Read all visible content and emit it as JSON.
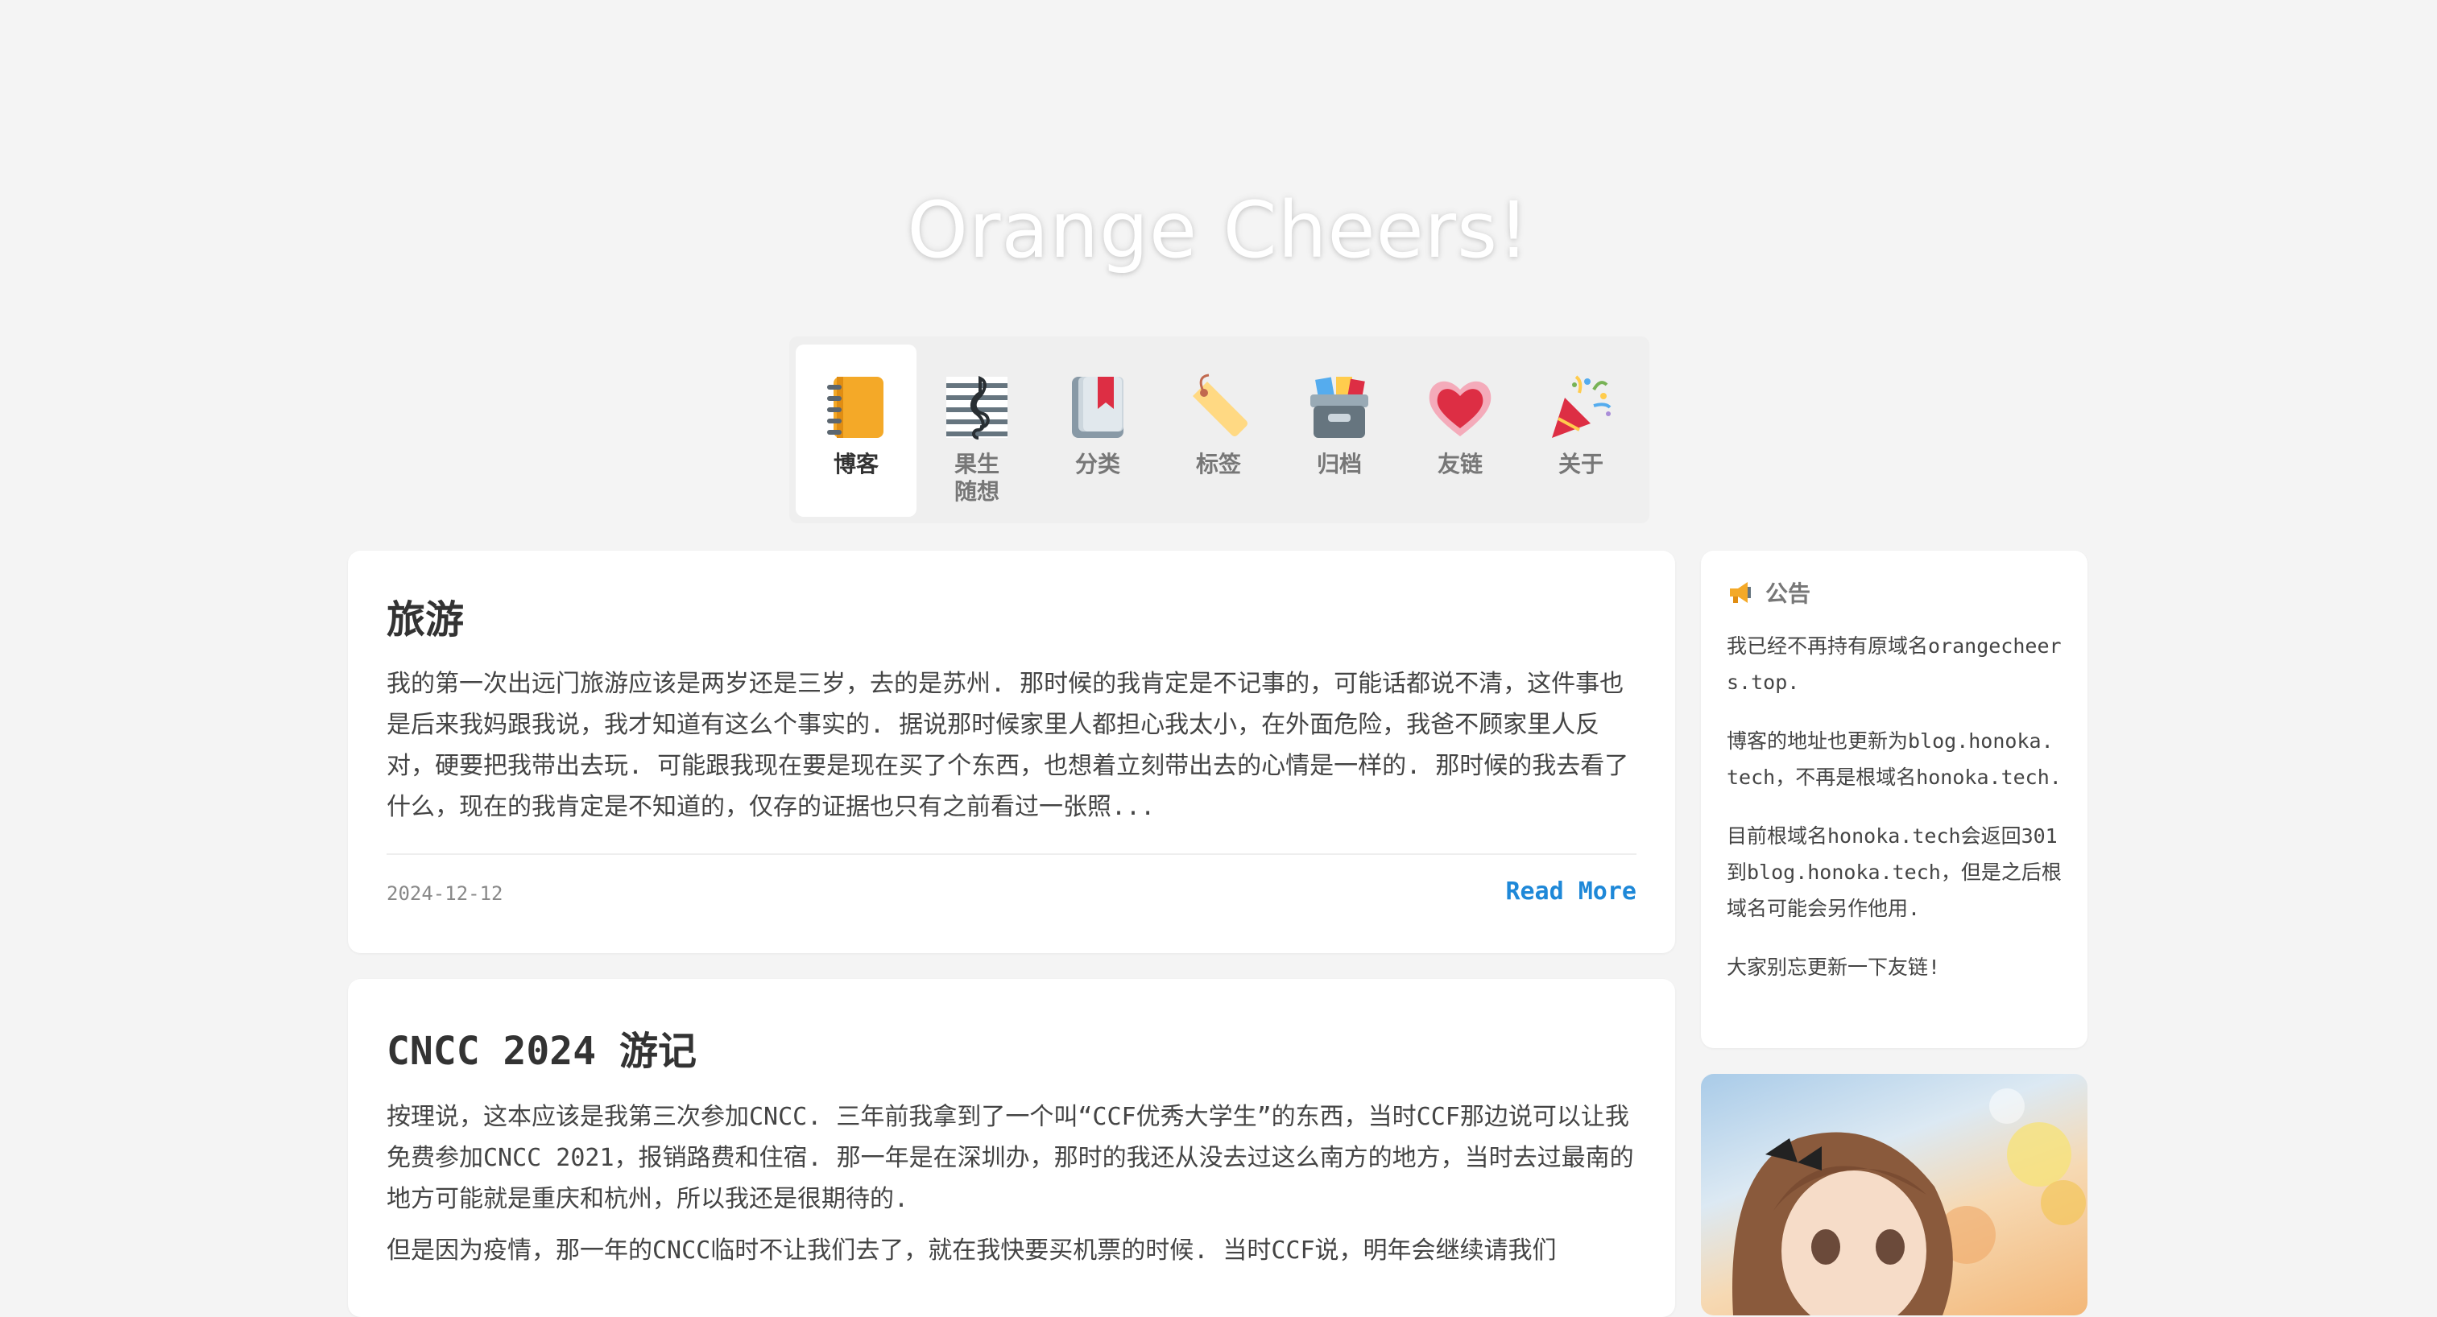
{
  "site": {
    "title": "Orange Cheers!"
  },
  "nav": {
    "items": [
      {
        "label": "博客",
        "icon": "notebook-icon",
        "active": true
      },
      {
        "label": "果生随想",
        "icon": "music-score-icon",
        "active": false
      },
      {
        "label": "分类",
        "icon": "book-bookmark-icon",
        "active": false
      },
      {
        "label": "标签",
        "icon": "tag-icon",
        "active": false
      },
      {
        "label": "归档",
        "icon": "archive-box-icon",
        "active": false
      },
      {
        "label": "友链",
        "icon": "heart-icon",
        "active": false
      },
      {
        "label": "关于",
        "icon": "party-popper-icon",
        "active": false
      }
    ]
  },
  "posts": [
    {
      "title": "旅游",
      "excerpt": "我的第一次出远门旅游应该是两岁还是三岁，去的是苏州. 那时候的我肯定是不记事的，可能话都说不清，这件事也是后来我妈跟我说，我才知道有这么个事实的. 据说那时候家里人都担心我太小，在外面危险，我爸不顾家里人反对，硬要把我带出去玩. 可能跟我现在要是现在买了个东西，也想着立刻带出去的心情是一样的. 那时候的我去看了什么，现在的我肯定是不知道的，仅存的证据也只有之前看过一张照...",
      "date": "2024-12-12",
      "read_more": "Read More"
    },
    {
      "title": "CNCC 2024 游记",
      "excerpt": "按理说，这本应该是我第三次参加CNCC. 三年前我拿到了一个叫“CCF优秀大学生”的东西，当时CCF那边说可以让我免费参加CNCC 2021，报销路费和住宿. 那一年是在深圳办，那时的我还从没去过这么南方的地方，当时去过最南的地方可能就是重庆和杭州，所以我还是很期待的.",
      "excerpt2": "但是因为疫情，那一年的CNCC临时不让我们去了，就在我快要买机票的时候. 当时CCF说，明年会继续请我们"
    }
  ],
  "notice": {
    "icon": "megaphone-icon",
    "title": "公告",
    "paragraphs": [
      "我已经不再持有原域名orangecheers.top.",
      "博客的地址也更新为blog.honoka.tech，不再是根域名honoka.tech.",
      "目前根域名honoka.tech会返回301到blog.honoka.tech，但是之后根域名可能会另作他用.",
      "大家别忘更新一下友链!"
    ]
  },
  "colors": {
    "accent": "#1e88d8",
    "background": "#f4f4f4"
  }
}
